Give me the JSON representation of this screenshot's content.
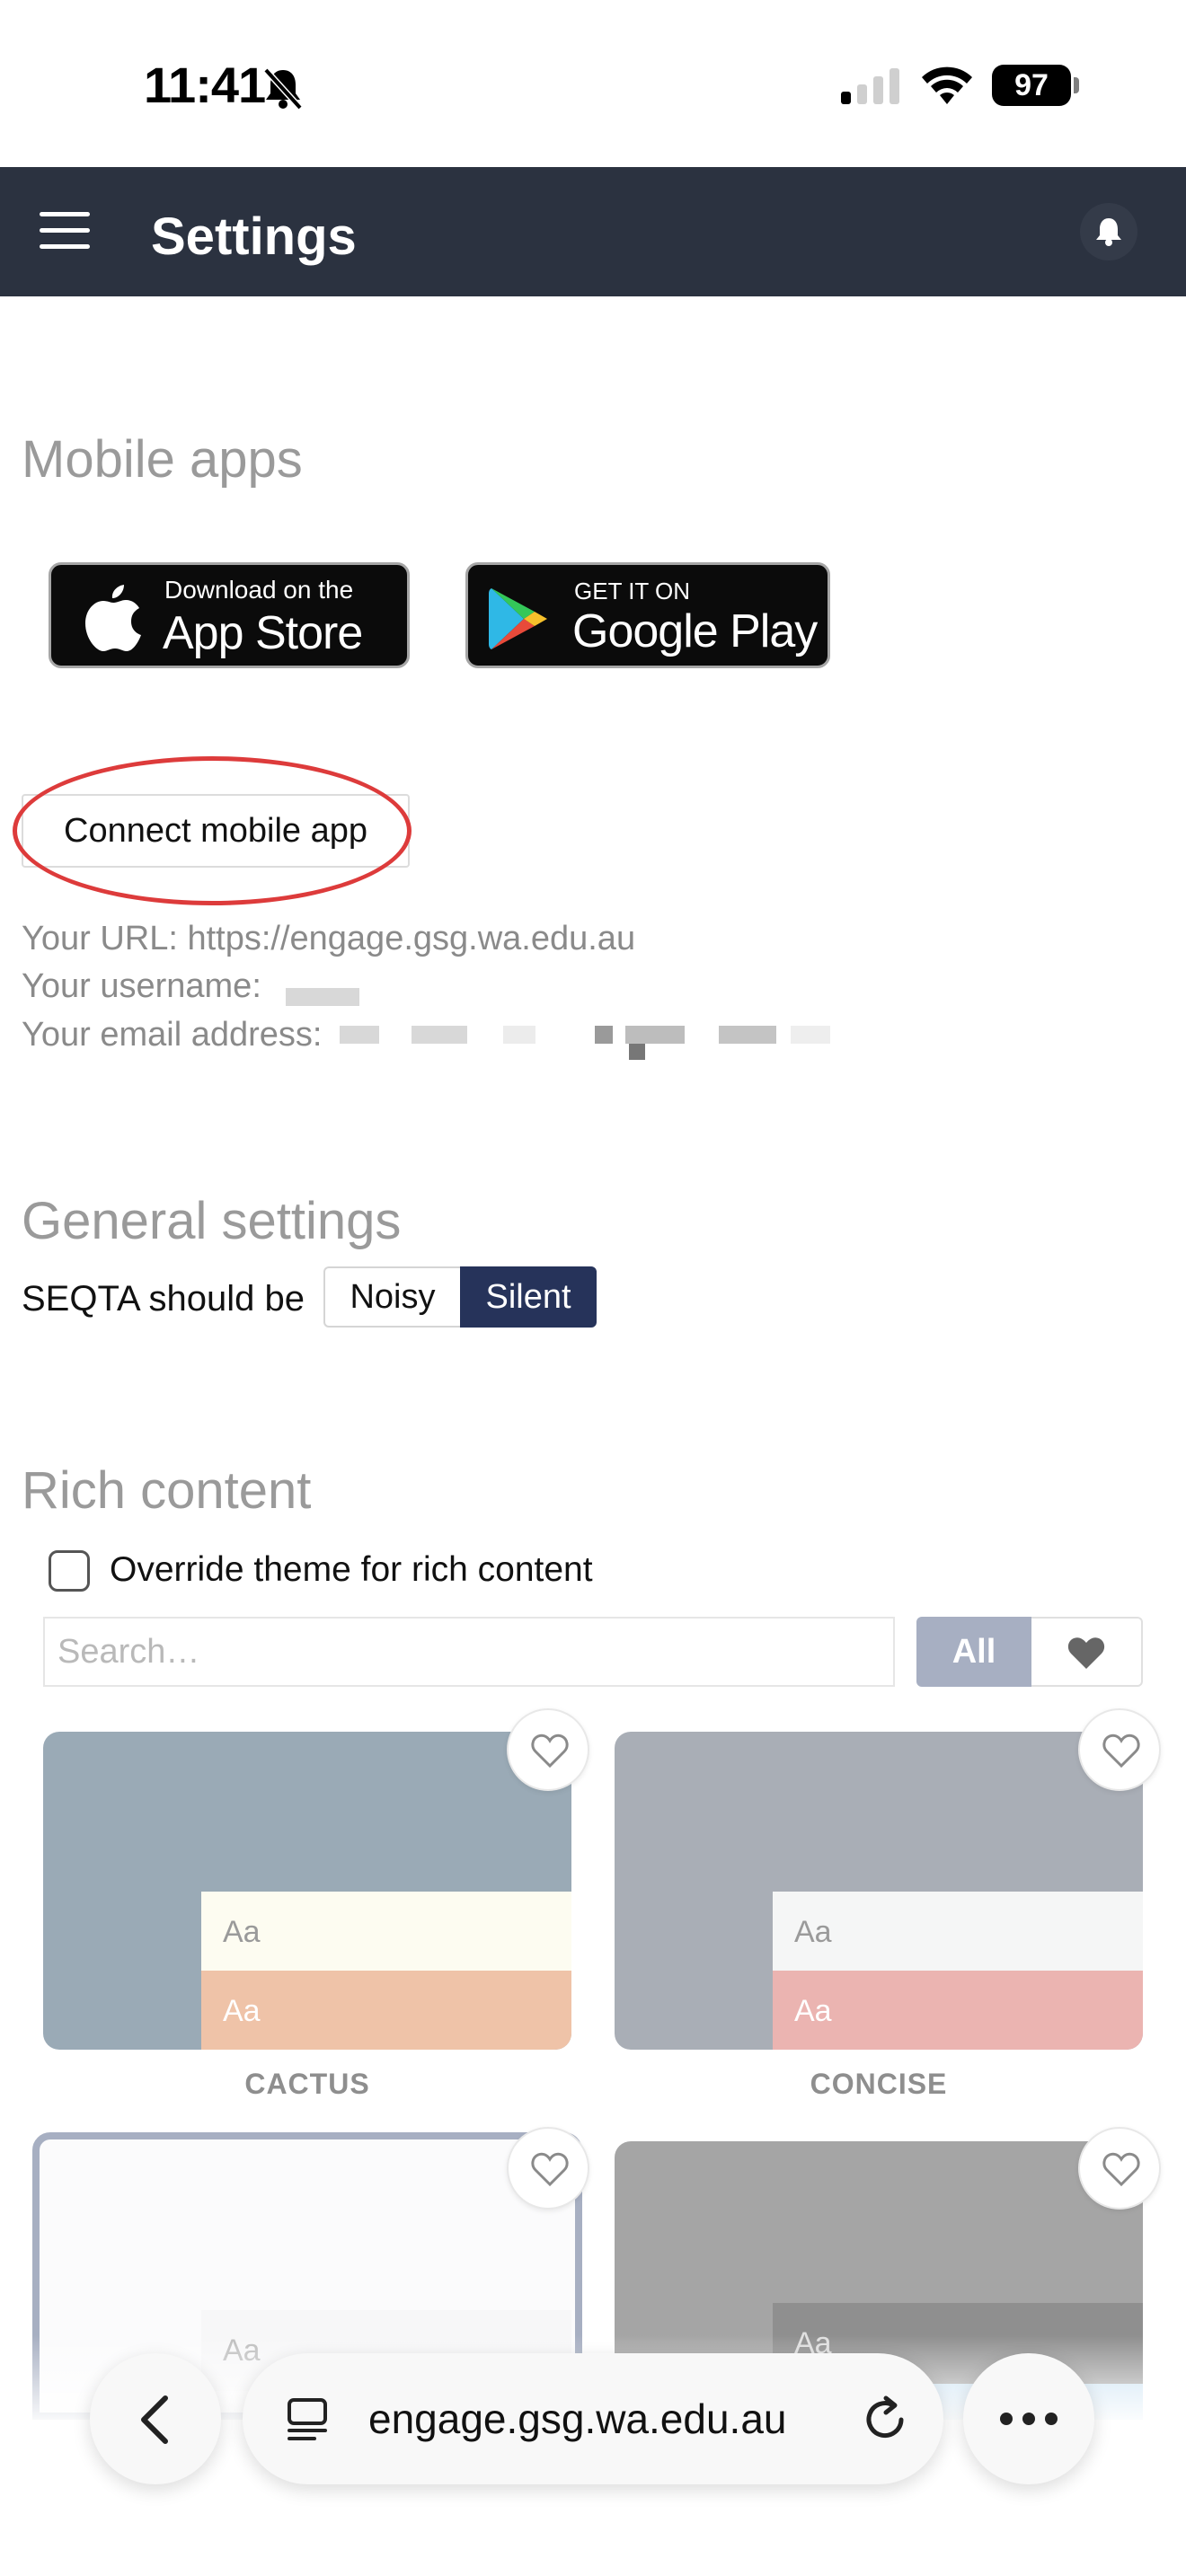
{
  "status_bar": {
    "time": "11:41",
    "battery": "97"
  },
  "header": {
    "title": "Settings"
  },
  "mobile_apps": {
    "section_title": "Mobile apps",
    "app_store": {
      "small": "Download on the",
      "big": "App Store"
    },
    "google_play": {
      "small": "GET IT ON",
      "big": "Google Play"
    },
    "connect_button": "Connect mobile app",
    "url_line": "Your URL: https://engage.gsg.wa.edu.au",
    "username_label": "Your username:",
    "email_label": "Your email address:"
  },
  "general_settings": {
    "section_title": "General settings",
    "mode_label": "SEQTA should be",
    "options": [
      "Noisy",
      "Silent"
    ],
    "selected": "Silent"
  },
  "rich_content": {
    "section_title": "Rich content",
    "override_label": "Override theme for rich content",
    "override_checked": false,
    "search_placeholder": "Search…",
    "filter_all": "All",
    "themes": [
      {
        "name": "CACTUS",
        "sample": "Aa",
        "bg": "#9aaab6",
        "row1": "#fdfcf1",
        "row2": "#efc3a8"
      },
      {
        "name": "CONCISE",
        "sample": "Aa",
        "bg": "#a9aeb6",
        "row1": "#f5f6f6",
        "row2": "#ebb4b1"
      },
      {
        "name": "",
        "sample": "Aa"
      },
      {
        "name": "",
        "sample": "Aa"
      }
    ]
  },
  "browser": {
    "url": "engage.gsg.wa.edu.au"
  }
}
